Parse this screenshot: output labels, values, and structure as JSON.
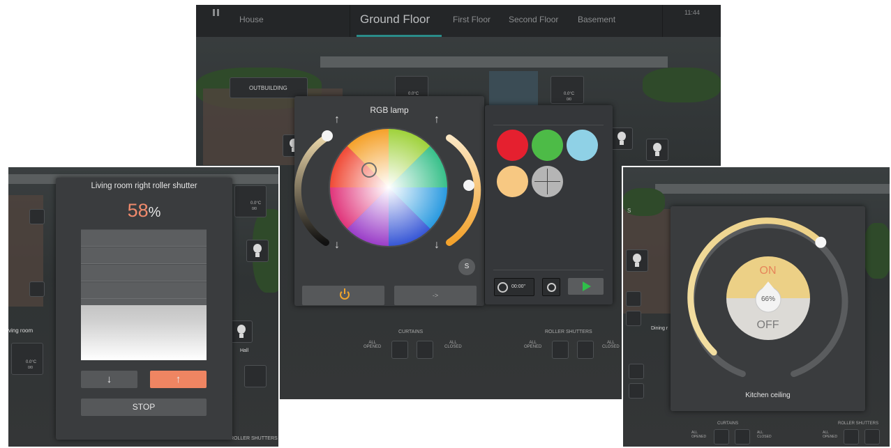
{
  "top_screen": {
    "menu_icon": "pause-icon",
    "tabs": [
      {
        "label": "House"
      },
      {
        "label": "Ground Floor"
      },
      {
        "label": "First Floor"
      },
      {
        "label": "Second Floor"
      },
      {
        "label": "Basement"
      }
    ],
    "time": "11:44",
    "outbuilding_label": "OUTBUILDING",
    "tile_temp": "0.0°C",
    "tile_temp_sub": "0/0",
    "rgb_panel": {
      "title": "RGB lamp",
      "s_label": "S",
      "power_icon": "power-icon",
      "next_label": "->",
      "colors": [
        "#e5202f",
        "#4dbb47",
        "#8fd1e6",
        "#f7c882"
      ],
      "timer_value": "00:00\"",
      "play_icon": "play-icon"
    },
    "curtains": {
      "title": "CURTAINS",
      "opened": "ALL\nOPENED",
      "closed": "ALL\nCLOSED"
    },
    "roller_shutters": {
      "title": "ROLLER SHUTTERS",
      "opened": "ALL\nOPENED",
      "closed": "ALL\nCLOSED"
    }
  },
  "left_screen": {
    "title": "Living room right roller shutter",
    "percent_value": "58",
    "percent_unit": "%",
    "down_icon": "↓",
    "up_icon": "↑",
    "stop_label": "STOP",
    "room_label": "ving room",
    "room_temp": "0.0°C",
    "room_temp_sub": "0/0",
    "hall_label": "Hall",
    "tile_temp": "0.0°C",
    "tile_temp_sub": "0/0",
    "bottom_label": "ROLLER SHUTTERS",
    "shutter_level": 0.58
  },
  "right_screen": {
    "on_label": "ON",
    "off_label": "OFF",
    "percent": "66%",
    "dimmer_level": 0.66,
    "name": "Kitchen ceiling",
    "side_label": "Dining r",
    "curtains": {
      "title": "CURTAINS",
      "opened": "ALL\nOPENED",
      "closed": "ALL\nCLOSED"
    },
    "roller_shutters": {
      "title": "ROLLER SHUTTERS",
      "opened": "ALL\nOPENED"
    },
    "top_label": "S"
  }
}
